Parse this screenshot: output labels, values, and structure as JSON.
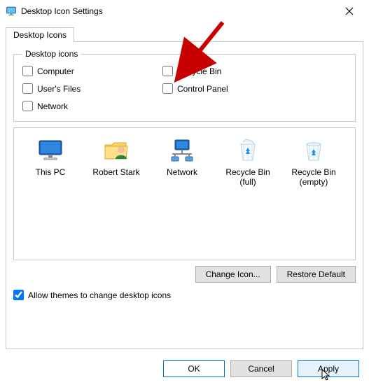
{
  "window": {
    "title": "Desktop Icon Settings"
  },
  "tabs": {
    "main": "Desktop Icons"
  },
  "group": {
    "legend": "Desktop icons"
  },
  "checks": {
    "computer": "Computer",
    "recycle": "Recycle Bin",
    "userfiles": "User's Files",
    "cpanel": "Control Panel",
    "network": "Network"
  },
  "icons": {
    "thispc": "This PC",
    "user": "Robert Stark",
    "network": "Network",
    "rb_full": "Recycle Bin (full)",
    "rb_empty": "Recycle Bin (empty)"
  },
  "buttons": {
    "change_icon": "Change Icon...",
    "restore_default": "Restore Default",
    "ok": "OK",
    "cancel": "Cancel",
    "apply": "Apply"
  },
  "allow_themes": {
    "label": "Allow themes to change desktop icons",
    "checked": true
  }
}
